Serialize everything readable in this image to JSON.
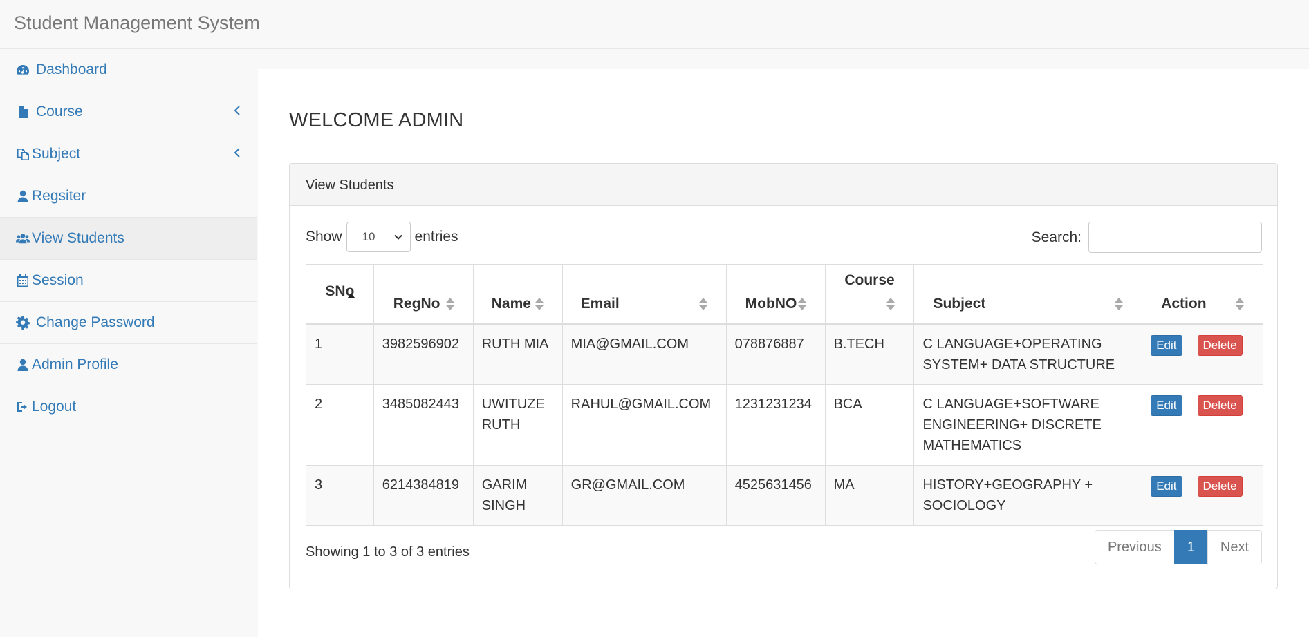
{
  "app": {
    "title": "Student Management System"
  },
  "sidebar": {
    "items": [
      {
        "label": "Dashboard",
        "icon": "dashboard-icon"
      },
      {
        "label": "Course",
        "icon": "file-icon",
        "has_submenu": true
      },
      {
        "label": "Subject",
        "icon": "copy-icon",
        "has_submenu": true
      },
      {
        "label": "Regsiter",
        "icon": "user-icon"
      },
      {
        "label": "View Students",
        "icon": "users-icon",
        "active": true
      },
      {
        "label": "Session",
        "icon": "calendar-icon"
      },
      {
        "label": "Change Password",
        "icon": "gear-icon"
      },
      {
        "label": "Admin Profile",
        "icon": "user-icon"
      },
      {
        "label": "Logout",
        "icon": "sign-out-icon"
      }
    ]
  },
  "main": {
    "heading": "WELCOME ADMIN",
    "panel_title": "View Students",
    "length": {
      "show": "Show",
      "value": "10",
      "entries": "entries"
    },
    "search": {
      "label": "Search:",
      "value": ""
    },
    "table": {
      "columns": [
        "SNo",
        "RegNo",
        "Name",
        "Email",
        "MobNO",
        "Course",
        "Subject",
        "Action"
      ],
      "sorted_column": "SNo",
      "sort_direction": "asc",
      "rows": [
        {
          "sno": "1",
          "regno": "3982596902",
          "name": "RUTH MIA",
          "email": "MIA@GMAIL.COM",
          "mob": "078876887",
          "course": "B.TECH",
          "subject": "C LANGUAGE+OPERATING SYSTEM+ DATA STRUCTURE"
        },
        {
          "sno": "2",
          "regno": "3485082443",
          "name": "UWITUZE RUTH",
          "email": "RAHUL@GMAIL.COM",
          "mob": "1231231234",
          "course": "BCA",
          "subject": "C LANGUAGE+SOFTWARE ENGINEERING+ DISCRETE MATHEMATICS"
        },
        {
          "sno": "3",
          "regno": "6214384819",
          "name": "GARIM SINGH",
          "email": "GR@GMAIL.COM",
          "mob": "4525631456",
          "course": "MA",
          "subject": "HISTORY+GEOGRAPHY + SOCIOLOGY"
        }
      ],
      "edit_label": "Edit",
      "delete_label": "Delete"
    },
    "info": "Showing 1 to 3 of 3 entries",
    "pagination": {
      "previous": "Previous",
      "current": "1",
      "next": "Next"
    }
  },
  "colors": {
    "link": "#337ab7",
    "danger": "#d9534f",
    "active_bg": "#eeeeee"
  }
}
